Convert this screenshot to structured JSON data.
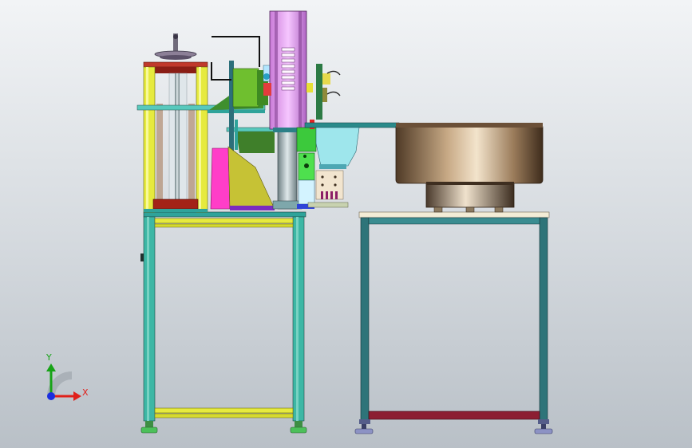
{
  "viewport": {
    "background_top": "#f2f4f6",
    "background_bottom": "#b9c0c7"
  },
  "triad": {
    "x_label": "X",
    "y_label": "Y",
    "x_color": "#e0201a",
    "y_color": "#17a317",
    "z_color": "#1a2ee0"
  },
  "model": {
    "frame_color": "#2fa39a",
    "frame_yellow": "#e6ea3e",
    "table_frame_color": "#2e7479",
    "bowl_color": "#a08466",
    "cylinder_color": "#e79af5",
    "guard_color": "#ff3ec8",
    "hopper_color": "#c6c235"
  }
}
